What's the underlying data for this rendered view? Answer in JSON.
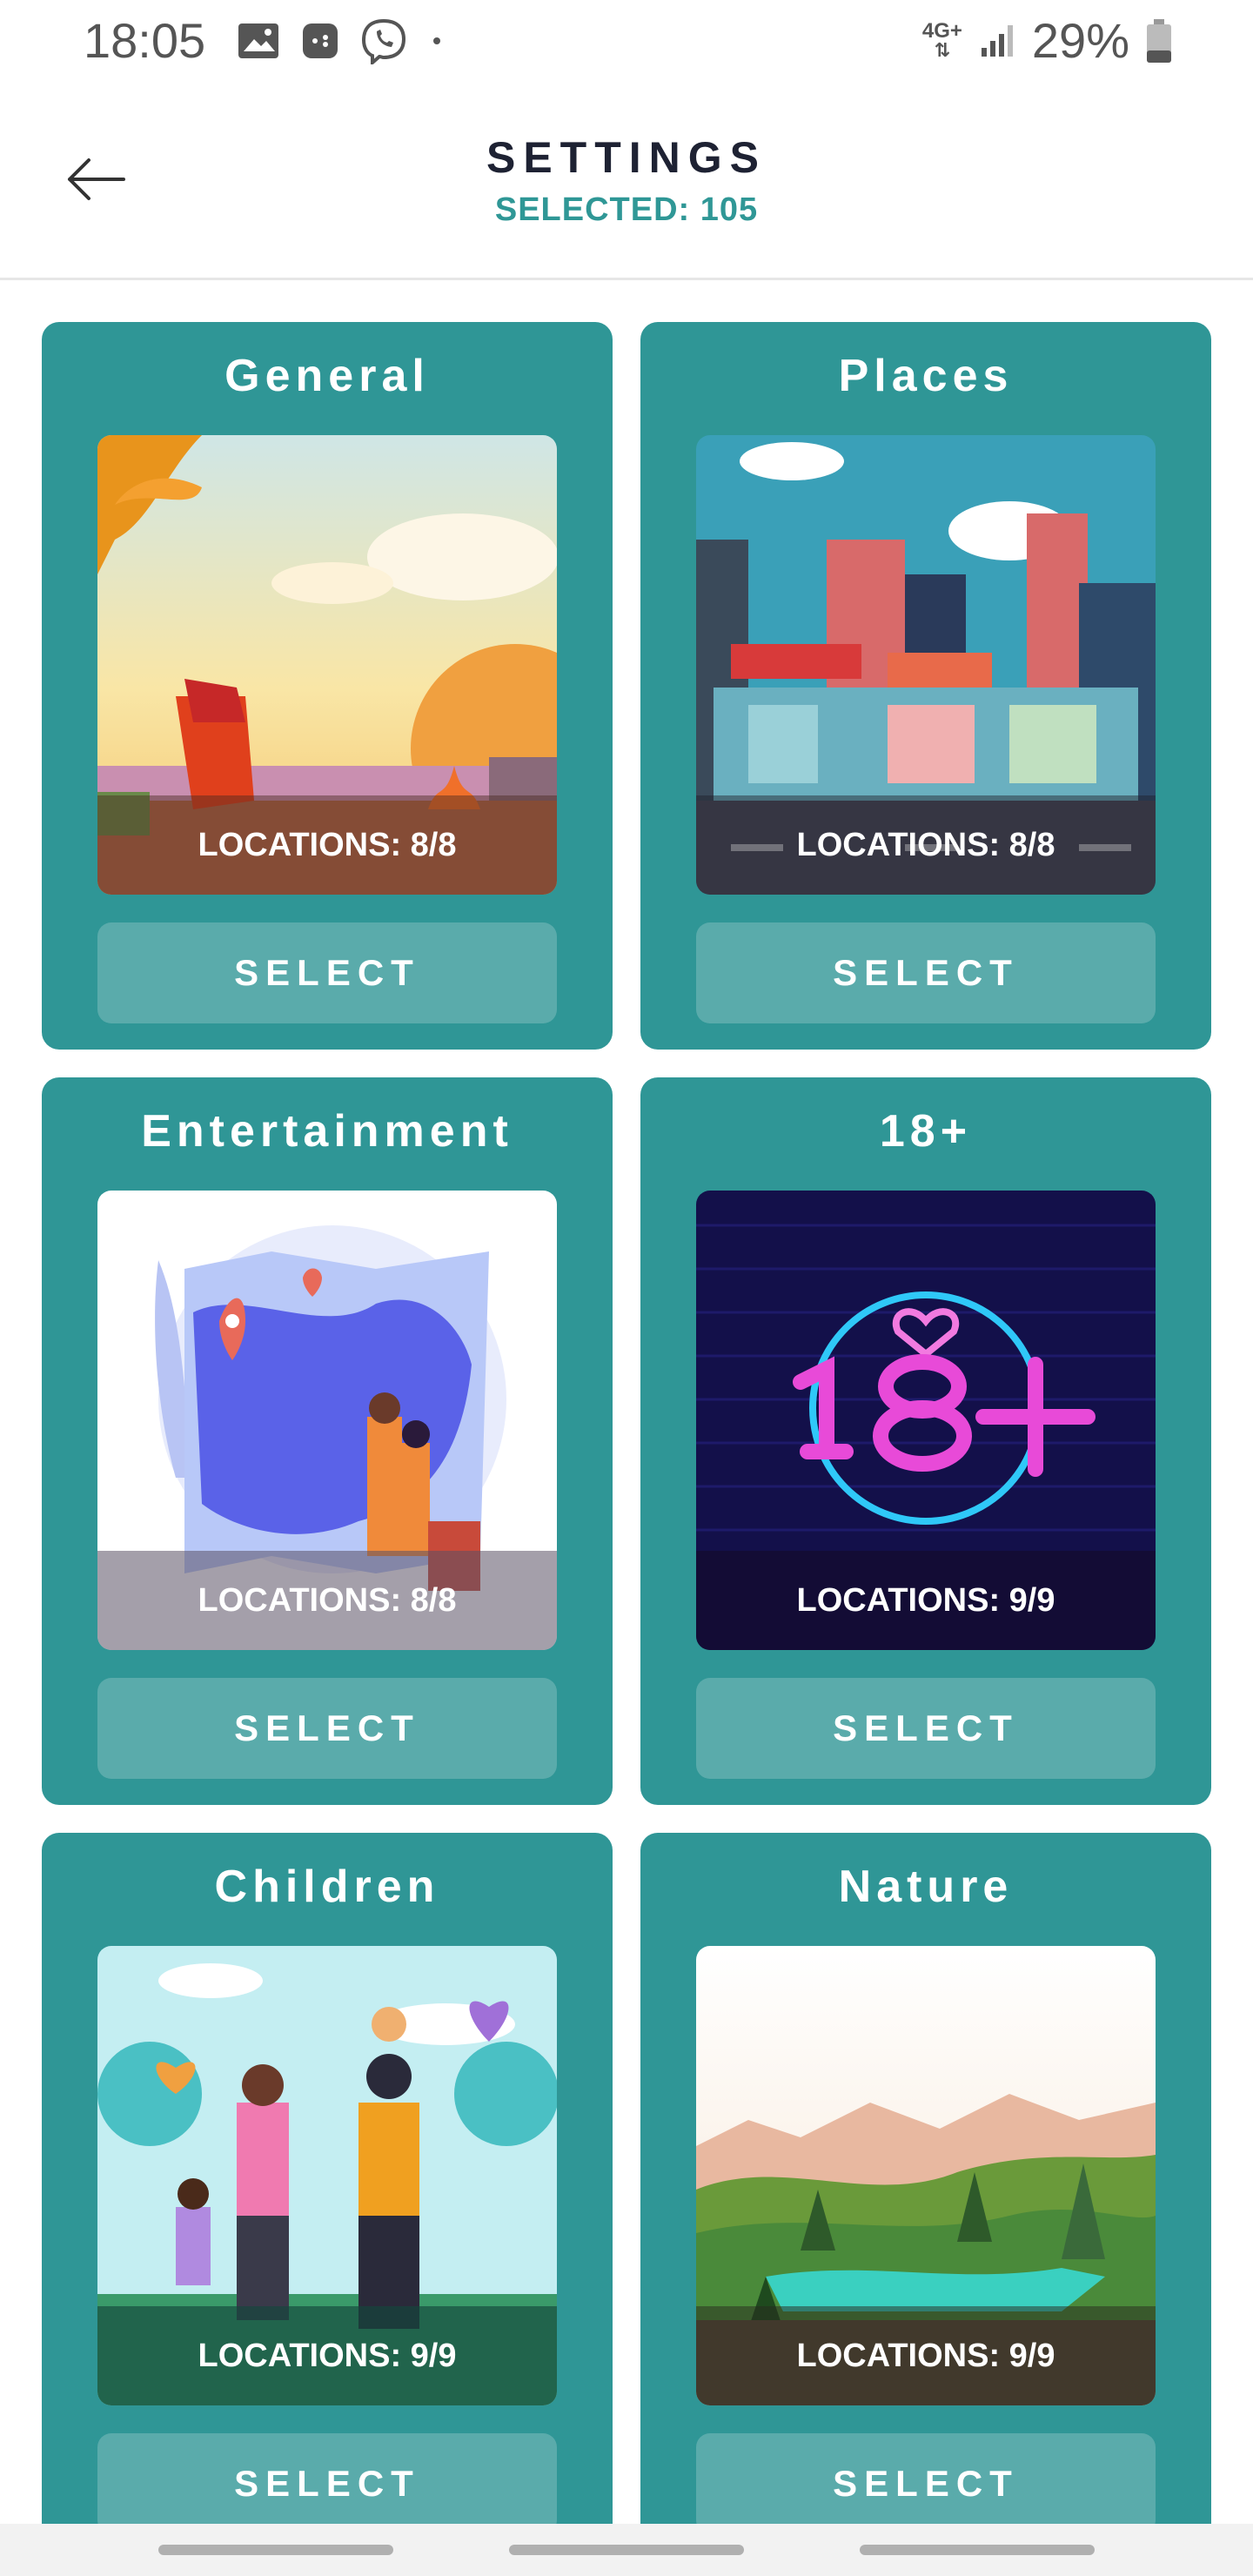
{
  "status_bar": {
    "time": "18:05",
    "network": "4G+",
    "battery": "29%",
    "icons": [
      "image-icon",
      "game-icon",
      "viber-icon",
      "dot-icon"
    ]
  },
  "header": {
    "title": "SETTINGS",
    "subtitle": "SELECTED: 105"
  },
  "categories": [
    {
      "title": "General",
      "locations": "LOCATIONS: 8/8",
      "button": "SELECT",
      "image": "autumn-campfire-illustration"
    },
    {
      "title": "Places",
      "locations": "LOCATIONS: 8/8",
      "button": "SELECT",
      "image": "city-street-illustration"
    },
    {
      "title": "Entertainment",
      "locations": "LOCATIONS: 8/8",
      "button": "SELECT",
      "image": "map-travelers-illustration"
    },
    {
      "title": "18+",
      "locations": "LOCATIONS: 9/9",
      "button": "SELECT",
      "image": "neon-18-plus-illustration"
    },
    {
      "title": "Children",
      "locations": "LOCATIONS: 9/9",
      "button": "SELECT",
      "image": "family-park-illustration"
    },
    {
      "title": "Nature",
      "locations": "LOCATIONS: 9/9",
      "button": "SELECT",
      "image": "forest-landscape-illustration"
    }
  ],
  "colors": {
    "card": "#2f9696",
    "button": "#5aabab",
    "accent": "#2f9796",
    "title": "#1e2233"
  }
}
